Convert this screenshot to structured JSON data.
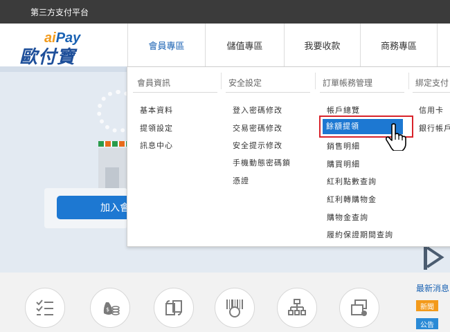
{
  "topbar": {
    "title": "第三方支付平台"
  },
  "logo": {
    "top_ai": "ai",
    "top_pay": "Pay",
    "bottom": "歐付寶"
  },
  "nav": {
    "items": [
      "會員專區",
      "儲值專區",
      "我要收款",
      "商務專區"
    ]
  },
  "hero": {
    "join_label": "加入會"
  },
  "dropdown": {
    "columns": [
      {
        "header": "會員資訊",
        "items": [
          "基本資料",
          "提領設定",
          "訊息中心"
        ]
      },
      {
        "header": "安全設定",
        "items": [
          "登入密碼修改",
          "交易密碼修改",
          "安全提示修改",
          "手機動態密碼鎖",
          "憑證"
        ]
      },
      {
        "header": "訂單帳務管理",
        "items": [
          "帳戶總覽",
          "餘額提領",
          "銷售明細",
          "購買明細",
          "紅利點數查詢",
          "紅利轉購物金",
          "購物金查詢",
          "履約保證期間查詢"
        ]
      },
      {
        "header": "綁定支付",
        "items": [
          "信用卡",
          "銀行帳戶"
        ]
      }
    ],
    "active_item": "餘額提領"
  },
  "news": {
    "title": "最新消息",
    "new_badge": "新聞",
    "notice_badge": "公告"
  },
  "colors": {
    "accent": "#1d78d2",
    "highlight": "#d8222a",
    "topbar": "#3b3b3b"
  }
}
